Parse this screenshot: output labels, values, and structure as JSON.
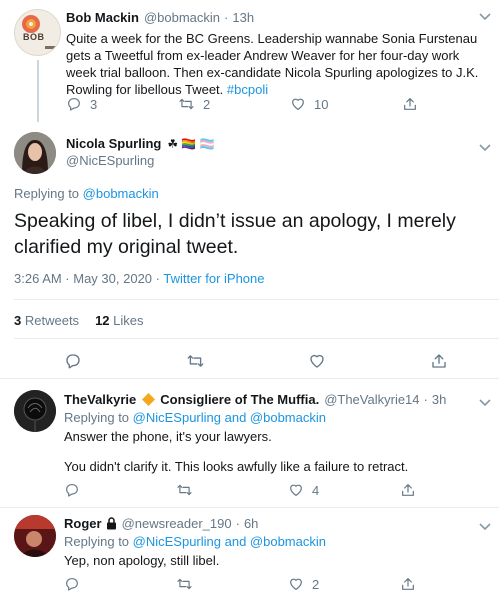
{
  "tweet1": {
    "name": "Bob Mackin",
    "handle": "@bobmackin",
    "time": "13h",
    "avatar_text": "BOB",
    "text": "Quite a week for the BC Greens. Leadership wannabe Sonia Furstenau gets a Tweetful from ex-leader Andrew Weaver for her four-day work week trial balloon. Then ex-candidate Nicola Spurling apologizes to J.K. Rowling for libellous Tweet.",
    "hashtag": "#bcpoli",
    "replies": "3",
    "retweets": "2",
    "likes": "10"
  },
  "main": {
    "name": "Nicola Spurling",
    "name_emoji": "☘ 🏳️‍🌈 🏳️‍⚧️",
    "handle": "@NicESpurling",
    "replying_prefix": "Replying to ",
    "replying_to": "@bobmackin",
    "text": "Speaking of libel, I didn’t issue an apology, I merely clarified my original tweet.",
    "timestamp": "3:26 AM · May 30, 2020 · ",
    "source": "Twitter for iPhone",
    "retweet_count": "3",
    "retweet_label": "Retweets",
    "like_count": "12",
    "like_label": "Likes"
  },
  "reply1": {
    "name": "TheValkyrie",
    "name_suffix": "Consigliere of The Muffia.",
    "handle": "@TheValkyrie14",
    "time": "3h",
    "replying_prefix": "Replying to ",
    "replying_to": "@NicESpurling and @bobmackin",
    "line1": "Answer the phone, it's your lawyers.",
    "line2": "You didn't clarify it. This looks awfully like a failure to retract.",
    "likes": "4"
  },
  "reply2": {
    "name": "Roger",
    "handle": "@newsreader_190",
    "time": "6h",
    "replying_prefix": "Replying to ",
    "replying_to": "@NicESpurling and @bobmackin",
    "text": "Yep, non apology, still libel.",
    "likes": "2"
  },
  "colors": {
    "accent": "#1b95e0",
    "secondary_text": "#657786",
    "divider": "#e6ecf0",
    "thread_line": "#ccd6dd",
    "diamond": "#f4a81d"
  },
  "icons": [
    "reply-icon",
    "retweet-icon",
    "like-icon",
    "share-icon",
    "lock-icon",
    "more-icon"
  ]
}
